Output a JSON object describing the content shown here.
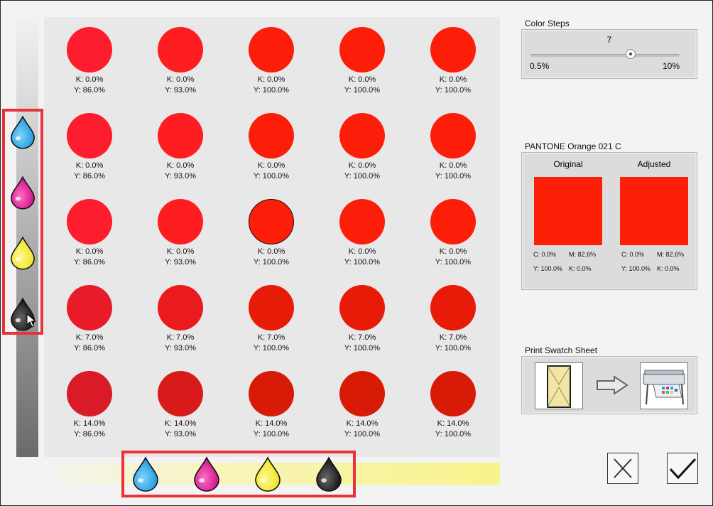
{
  "steps": {
    "title": "Color Steps",
    "value": "7",
    "min_label": "0.5%",
    "max_label": "10%",
    "position": 0.67
  },
  "pantone": {
    "title": "PANTONE Orange 021 C",
    "original": {
      "label": "Original",
      "color": "#fc2008",
      "c": "C: 0.0%",
      "m": "M: 82.6%",
      "y": "Y: 100.0%",
      "k": "K: 0.0%"
    },
    "adjusted": {
      "label": "Adjusted",
      "color": "#fc2008",
      "c": "C: 0.0%",
      "m": "M: 82.6%",
      "y": "Y: 100.0%",
      "k": "K: 0.0%"
    }
  },
  "print": {
    "title": "Print Swatch Sheet"
  },
  "ink_icons": [
    "cyan-drop-icon",
    "magenta-drop-icon",
    "yellow-drop-icon",
    "black-drop-icon"
  ],
  "grid": {
    "rows": [
      {
        "k": "K: 0.0%",
        "colors": [
          "#fe1d2e",
          "#fe1d21",
          "#fd1e0a",
          "#fd1e0a",
          "#fd1e0a"
        ]
      },
      {
        "k": "K: 0.0%",
        "colors": [
          "#fe1d2e",
          "#fe1d21",
          "#fd1e0a",
          "#fd1e0a",
          "#fd1e0a"
        ]
      },
      {
        "k": "K: 0.0%",
        "colors": [
          "#fe1d2e",
          "#fe1d21",
          "#fd1e0a",
          "#fd1e0a",
          "#fd1e0a"
        ]
      },
      {
        "k": "K: 7.0%",
        "colors": [
          "#ea1b29",
          "#ea1b1e",
          "#e81b09",
          "#e81b09",
          "#e81b09"
        ]
      },
      {
        "k": "K: 14.0%",
        "colors": [
          "#d91a27",
          "#d91a1b",
          "#d71b07",
          "#d71b07",
          "#d71b07"
        ]
      }
    ],
    "y_labels": [
      "Y: 86.0%",
      "Y: 93.0%",
      "Y: 100.0%",
      "Y: 100.0%",
      "Y: 100.0%"
    ],
    "selected": {
      "row": 2,
      "col": 2
    }
  }
}
